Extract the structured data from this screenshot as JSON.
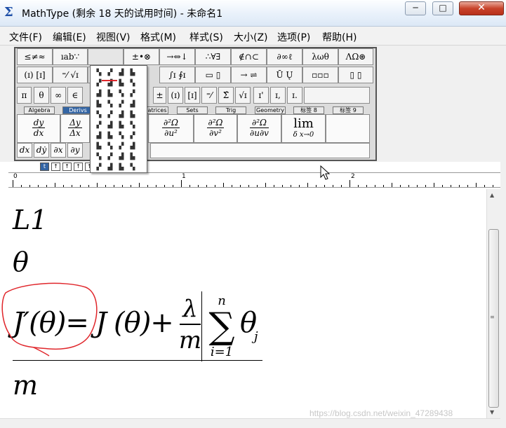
{
  "window": {
    "title": "MathType (剩余 18 天的试用时间) - 未命名1",
    "app_icon": "Σ",
    "minimize": "─",
    "maximize": "□",
    "close": "✕"
  },
  "menu": [
    "文件(F)",
    "编辑(E)",
    "视图(V)",
    "格式(M)",
    "样式(S)",
    "大小(Z)",
    "选项(P)",
    "帮助(H)"
  ],
  "toolbar": {
    "row1": [
      "≤≠≈",
      "ıab∵",
      "",
      "±•⊗",
      "→⇔↓",
      "∴∀∃",
      "∉∩⊂",
      "∂∞ℓ",
      "λωθ",
      "ΛΩ⊛"
    ],
    "row2": [
      "(ɪ) [ɪ]",
      "⁼⁄ √ɪ",
      "",
      "∫ɪ ∮ɪ",
      "▭ ▯",
      "→ ⇌",
      "Ū Ų",
      "▫▫▫",
      "▯ ▯"
    ],
    "row3": [
      "π",
      "θ",
      "∞",
      "∈",
      "±",
      "(ɪ)",
      "[ɪ]",
      "⁼⁄",
      "Σ̂",
      "√ɪ",
      "ɪ'",
      "ɪ,",
      "ɪ."
    ],
    "tabs": [
      "Algebra",
      "Derivs",
      "atrices",
      "Sets",
      "Trig",
      "Geometry",
      "标签 8",
      "标签 9"
    ],
    "templates": [
      {
        "num": "dy",
        "den": "dx"
      },
      {
        "num": "Δy",
        "den": "Δx"
      },
      {
        "num": "∂²Ω",
        "den": "∂u²"
      },
      {
        "num": "∂²Ω",
        "den": "∂v²"
      },
      {
        "num": "∂²Ω",
        "den": "∂u∂v"
      }
    ],
    "limit": {
      "top": "lim",
      "bottom": "δ x→0"
    },
    "small": [
      "dx",
      "dẏ",
      "∂x",
      "∂y"
    ],
    "sizes": [
      "t",
      "↑",
      "↑",
      "↑",
      "↑"
    ]
  },
  "ruler": {
    "labels": [
      "0",
      "1",
      "2"
    ]
  },
  "document": {
    "line1": "L1",
    "line2": "θ",
    "eq": {
      "lhs": "J′(θ)=",
      "rhs_j": "J",
      "rhs_theta": "(θ)+",
      "lambda": "λ",
      "m": "m",
      "sum": "∑",
      "sum_top": "n",
      "sum_bottom": "i=1",
      "theta_j": "θ",
      "sub_j": "j"
    },
    "line4": "m"
  },
  "watermark": "https://blog.csdn.net/weixin_47289438",
  "colors": {
    "annotation": "#e0262b",
    "active_tab": "#3465a4"
  }
}
